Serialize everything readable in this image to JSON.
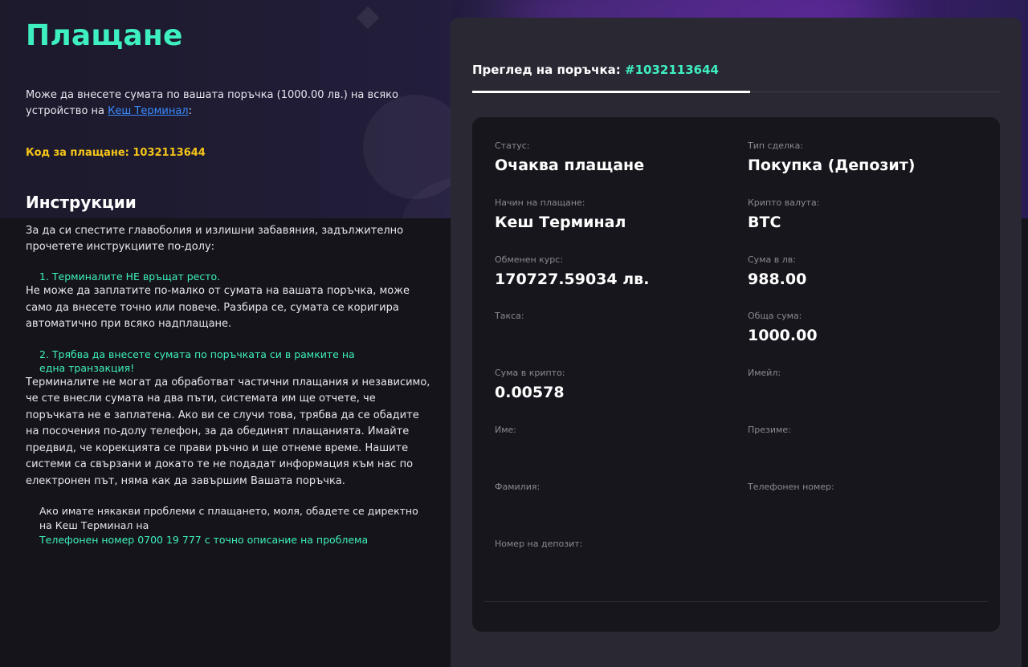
{
  "page": {
    "title": "Плащане",
    "intro_prefix": "Може да внесете сумата по вашата поръчка (1000.00 лв.) на всяко устройство на ",
    "intro_link": "Кеш Терминал",
    "intro_suffix": ":",
    "payment_code": "Код за плащане: 1032113644"
  },
  "instructions": {
    "title": "Инструкции",
    "intro": "За да си спестите главоболия и излишни забавяния, задължително прочетете инструкциите по-долу:",
    "rules": [
      {
        "head": "1. Терминалите НЕ връщат ресто.",
        "body": "Не може да заплатите по-малко от сумата на вашата поръчка, може само да внесете точно или повече. Разбира се, сумата се коригира автоматично при всяко надплащане."
      },
      {
        "head": "2. Трябва да внесете сумата по поръчката си в рамките на една транзакция!",
        "body": "Терминалите не могат да обработват частични плащания и независимо, че сте внесли сумата на два пъти, системата им ще отчете, че поръчката не е заплатена. Ако ви се случи това, трябва да се обадите на посочения по-долу телефон, за да обединят плащанията. Имайте предвид, че корекцията се прави ръчно и ще отнеме време. Нашите системи са свързани и докато те не подадат информация към нас по електронен път, няма как да завършим Вашата поръчка."
      }
    ],
    "contact_text": "Ако имате някакви проблеми с плащането, моля, обадете се директно на Кеш Терминал на",
    "contact_phone": "Телефонен номер 0700 19 777 с точно описание на проблема"
  },
  "order": {
    "header_label": "Преглед на поръчка: ",
    "order_number": "#1032113644",
    "fields": {
      "status": {
        "label": "Статус:",
        "value": "Очаква плащане"
      },
      "deal_type": {
        "label": "Тип сделка:",
        "value": "Покупка (Депозит)"
      },
      "payment_method": {
        "label": "Начин на плащане:",
        "value": "Кеш Терминал"
      },
      "crypto_currency": {
        "label": "Крипто валута:",
        "value": "BTC"
      },
      "exchange_rate": {
        "label": "Обменен курс:",
        "value": "170727.59034 лв."
      },
      "amount_bgn": {
        "label": "Сума в лв:",
        "value": "988.00"
      },
      "fee": {
        "label": "Такса:",
        "value": ""
      },
      "total": {
        "label": "Обща сума:",
        "value": "1000.00"
      },
      "amount_crypto": {
        "label": "Сума в крипто:",
        "value": "0.00578"
      },
      "email": {
        "label": "Имейл:",
        "value": ""
      },
      "first_name": {
        "label": "Име:",
        "value": ""
      },
      "middle_name": {
        "label": "Презиме:",
        "value": ""
      },
      "last_name": {
        "label": "Фамилия:",
        "value": ""
      },
      "phone": {
        "label": "Телефонен номер:",
        "value": ""
      },
      "deposit_number": {
        "label": "Номер на депозит:",
        "value": ""
      }
    }
  }
}
